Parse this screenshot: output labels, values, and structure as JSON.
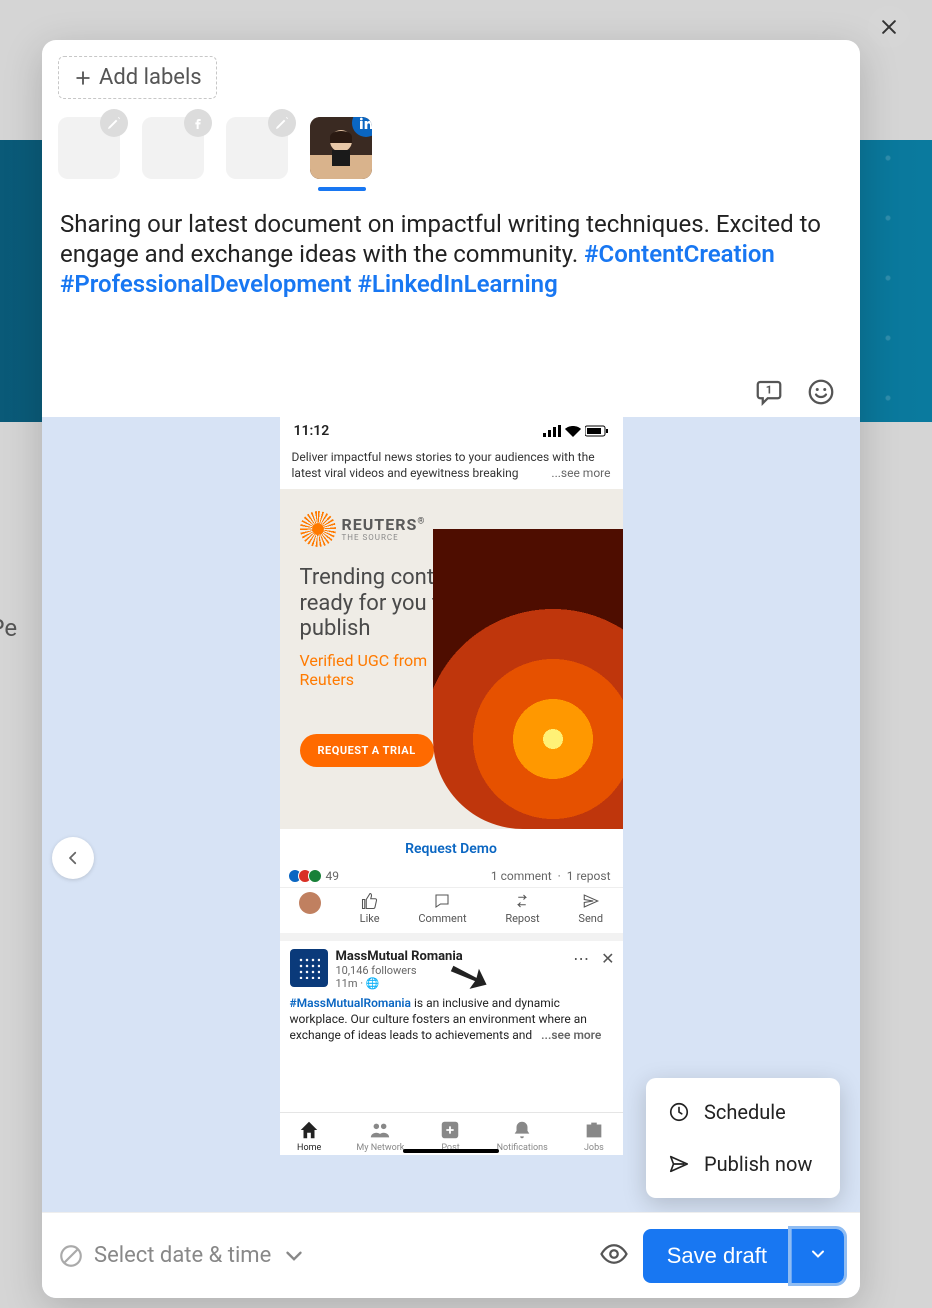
{
  "close_label": "Close",
  "add_labels_button": "Add labels",
  "channels": [
    {
      "name": "draft-1",
      "network": "pencil",
      "active": false
    },
    {
      "name": "facebook",
      "network": "facebook",
      "active": false
    },
    {
      "name": "draft-2",
      "network": "pencil",
      "active": false
    },
    {
      "name": "linkedin",
      "network": "linkedin",
      "active": true
    }
  ],
  "post_text_plain": "Sharing our latest document on impactful writing techniques. Excited to engage and exchange ideas with the community. ",
  "hashtags": [
    "#ContentCreation",
    "#ProfessionalDevelopment",
    "#LinkedInLearning"
  ],
  "phone": {
    "time": "11:12",
    "feed_text": "Deliver impactful news stories to your audiences with the latest viral videos and eyewitness breaking",
    "see_more": "...see more",
    "reuters_brand": "REUTERS",
    "reuters_sub": "THE SOURCE",
    "reuters_reg": "®",
    "ad_headline": "Trending content ready for you to publish",
    "ad_sub": "Verified UGC from Reuters",
    "trial_button": "REQUEST A TRIAL",
    "demo_link": "Request Demo",
    "reaction_count": "49",
    "comment_text": "1 comment",
    "repost_text": "1 repost",
    "actions": {
      "like": "Like",
      "comment": "Comment",
      "repost": "Repost",
      "send": "Send"
    },
    "mm_name": "MassMutual Romania",
    "mm_followers": "10,146 followers",
    "mm_time": "11m ·",
    "mm_tag": "#MassMutualRomania",
    "mm_body": " is an inclusive and dynamic workplace. Our culture fosters an environment where an exchange of ideas leads to achievements and",
    "mm_seemore": "...see more",
    "tabs": {
      "home": "Home",
      "network": "My Network",
      "post": "Post",
      "notifications": "Notifications",
      "jobs": "Jobs"
    }
  },
  "popup": {
    "schedule": "Schedule",
    "publish": "Publish now"
  },
  "footer": {
    "date_picker": "Select date & time",
    "save_draft": "Save draft"
  },
  "bg_text": "p Pe"
}
